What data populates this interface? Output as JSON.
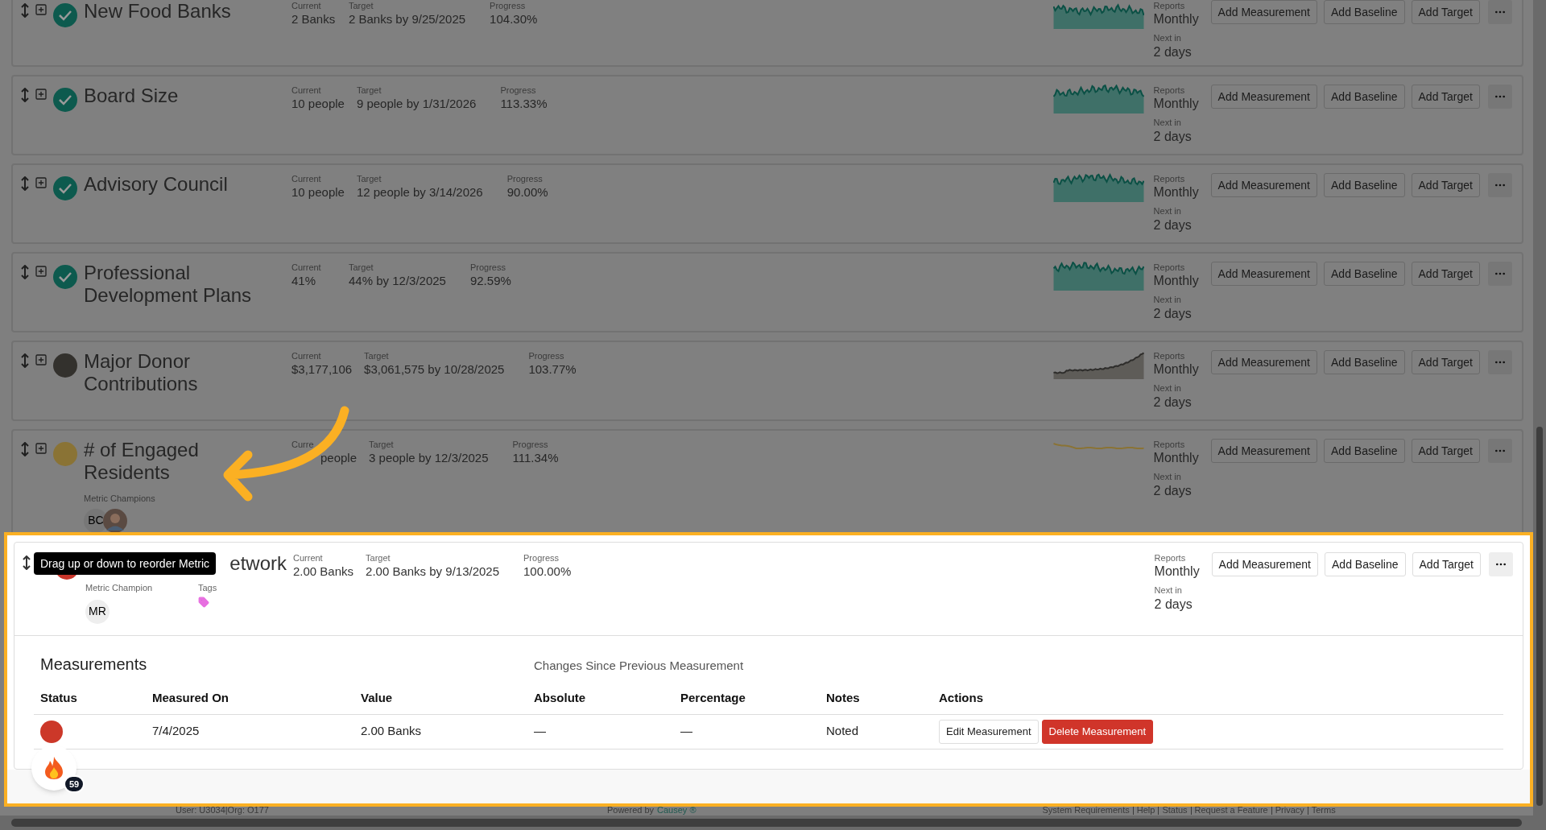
{
  "metrics": [
    {
      "title": "New Food Banks",
      "color": "#0d5a4e",
      "check": true,
      "current_label": "Current",
      "current": "2 Banks",
      "target_label": "Target",
      "target": "2 Banks by 9/25/2025",
      "progress_label": "Progress",
      "progress": "104.30%",
      "reports_label": "Reports",
      "frequency": "Monthly",
      "next_label": "Next in",
      "next": "2 days",
      "kind": "area",
      "buttons": [
        "Add Measurement",
        "Add Baseline",
        "Add Target"
      ]
    },
    {
      "title": "Board Size",
      "color": "#0d5a4e",
      "check": true,
      "current_label": "Current",
      "current": "10 people",
      "target_label": "Target",
      "target": "9 people by 1/31/2026",
      "progress_label": "Progress",
      "progress": "113.33%",
      "reports_label": "Reports",
      "frequency": "Monthly",
      "next_label": "Next in",
      "next": "2 days",
      "kind": "area",
      "buttons": [
        "Add Measurement",
        "Add Baseline",
        "Add Target"
      ]
    },
    {
      "title": "Advisory Council",
      "color": "#0d5a4e",
      "check": true,
      "current_label": "Current",
      "current": "10 people",
      "target_label": "Target",
      "target": "12 people by 3/14/2026",
      "progress_label": "Progress",
      "progress": "90.00%",
      "reports_label": "Reports",
      "frequency": "Monthly",
      "next_label": "Next in",
      "next": "2 days",
      "kind": "area",
      "buttons": [
        "Add Measurement",
        "Add Baseline",
        "Add Target"
      ]
    },
    {
      "title": "Professional Development Plans",
      "color": "#0d5a4e",
      "check": true,
      "current_label": "Current",
      "current": "41%",
      "target_label": "Target",
      "target": "44% by 12/3/2025",
      "progress_label": "Progress",
      "progress": "92.59%",
      "reports_label": "Reports",
      "frequency": "Monthly",
      "next_label": "Next in",
      "next": "2 days",
      "kind": "area",
      "buttons": [
        "Add Measurement",
        "Add Baseline",
        "Add Target"
      ]
    },
    {
      "title": "Major Donor Contributions",
      "color": "#33312d",
      "check": false,
      "current_label": "Current",
      "current": "$3,177,106",
      "target_label": "Target",
      "target": "$3,061,575 by 10/28/2025",
      "progress_label": "Progress",
      "progress": "103.77%",
      "reports_label": "Reports",
      "frequency": "Monthly",
      "next_label": "Next in",
      "next": "2 days",
      "kind": "rising",
      "buttons": [
        "Add Measurement",
        "Add Baseline",
        "Add Target"
      ]
    },
    {
      "title": "# of Engaged Residents",
      "color": "#8a7335",
      "check": false,
      "current_label": "Curre",
      "current": "people",
      "target_label": "Target",
      "target": "3 people by 12/3/2025",
      "progress_label": "Progress",
      "progress": "111.34%",
      "reports_label": "Reports",
      "frequency": "Monthly",
      "next_label": "Next in",
      "next": "2 days",
      "kind": "line",
      "champions_label": "Metric Champions",
      "champions": [
        {
          "kind": "initials",
          "text": "BC"
        },
        {
          "kind": "photo"
        }
      ],
      "buttons": [
        "Add Measurement",
        "Add Baseline",
        "Add Target"
      ]
    }
  ],
  "focused_metric": {
    "title": "etwork",
    "color": "#c8352a",
    "current_label": "Current",
    "current": "2.00 Banks",
    "target_label": "Target",
    "target": "2.00 Banks by 9/13/2025",
    "progress_label": "Progress",
    "progress": "100.00%",
    "reports_label": "Reports",
    "frequency": "Monthly",
    "next_label": "Next in",
    "next": "2 days",
    "champions_label": "Metric Champion",
    "champions": [
      {
        "kind": "initials",
        "text": "MR"
      }
    ],
    "tags_label": "Tags",
    "tags": [
      {
        "color": "#e76fe0"
      }
    ],
    "buttons": [
      "Add Measurement",
      "Add Baseline",
      "Add Target"
    ]
  },
  "tooltip": {
    "text": "Drag up or down to reorder Metric"
  },
  "measurements": {
    "title": "Measurements",
    "changes_title": "Changes Since Previous Measurement",
    "columns": [
      "Status",
      "Measured On",
      "Value",
      "Absolute",
      "Percentage",
      "Notes",
      "Actions"
    ],
    "rows": [
      {
        "color": "#cc3829",
        "measured_on": "7/4/2025",
        "value": "2.00 Banks",
        "absolute": "—",
        "percentage": "—",
        "notes": "Noted",
        "actions": [
          {
            "label": "Edit Measurement",
            "kind": "default"
          },
          {
            "label": "Delete Measurement",
            "kind": "danger"
          }
        ]
      }
    ]
  },
  "fire_badge": {
    "count": "59"
  },
  "footer": {
    "user": "User: U3034|Org: O177",
    "powered_by": "Powered by",
    "brand": "Causey ®",
    "links": [
      "System Requirements",
      "Help",
      "Status",
      "Request a Feature",
      "Privacy",
      "Terms"
    ]
  }
}
